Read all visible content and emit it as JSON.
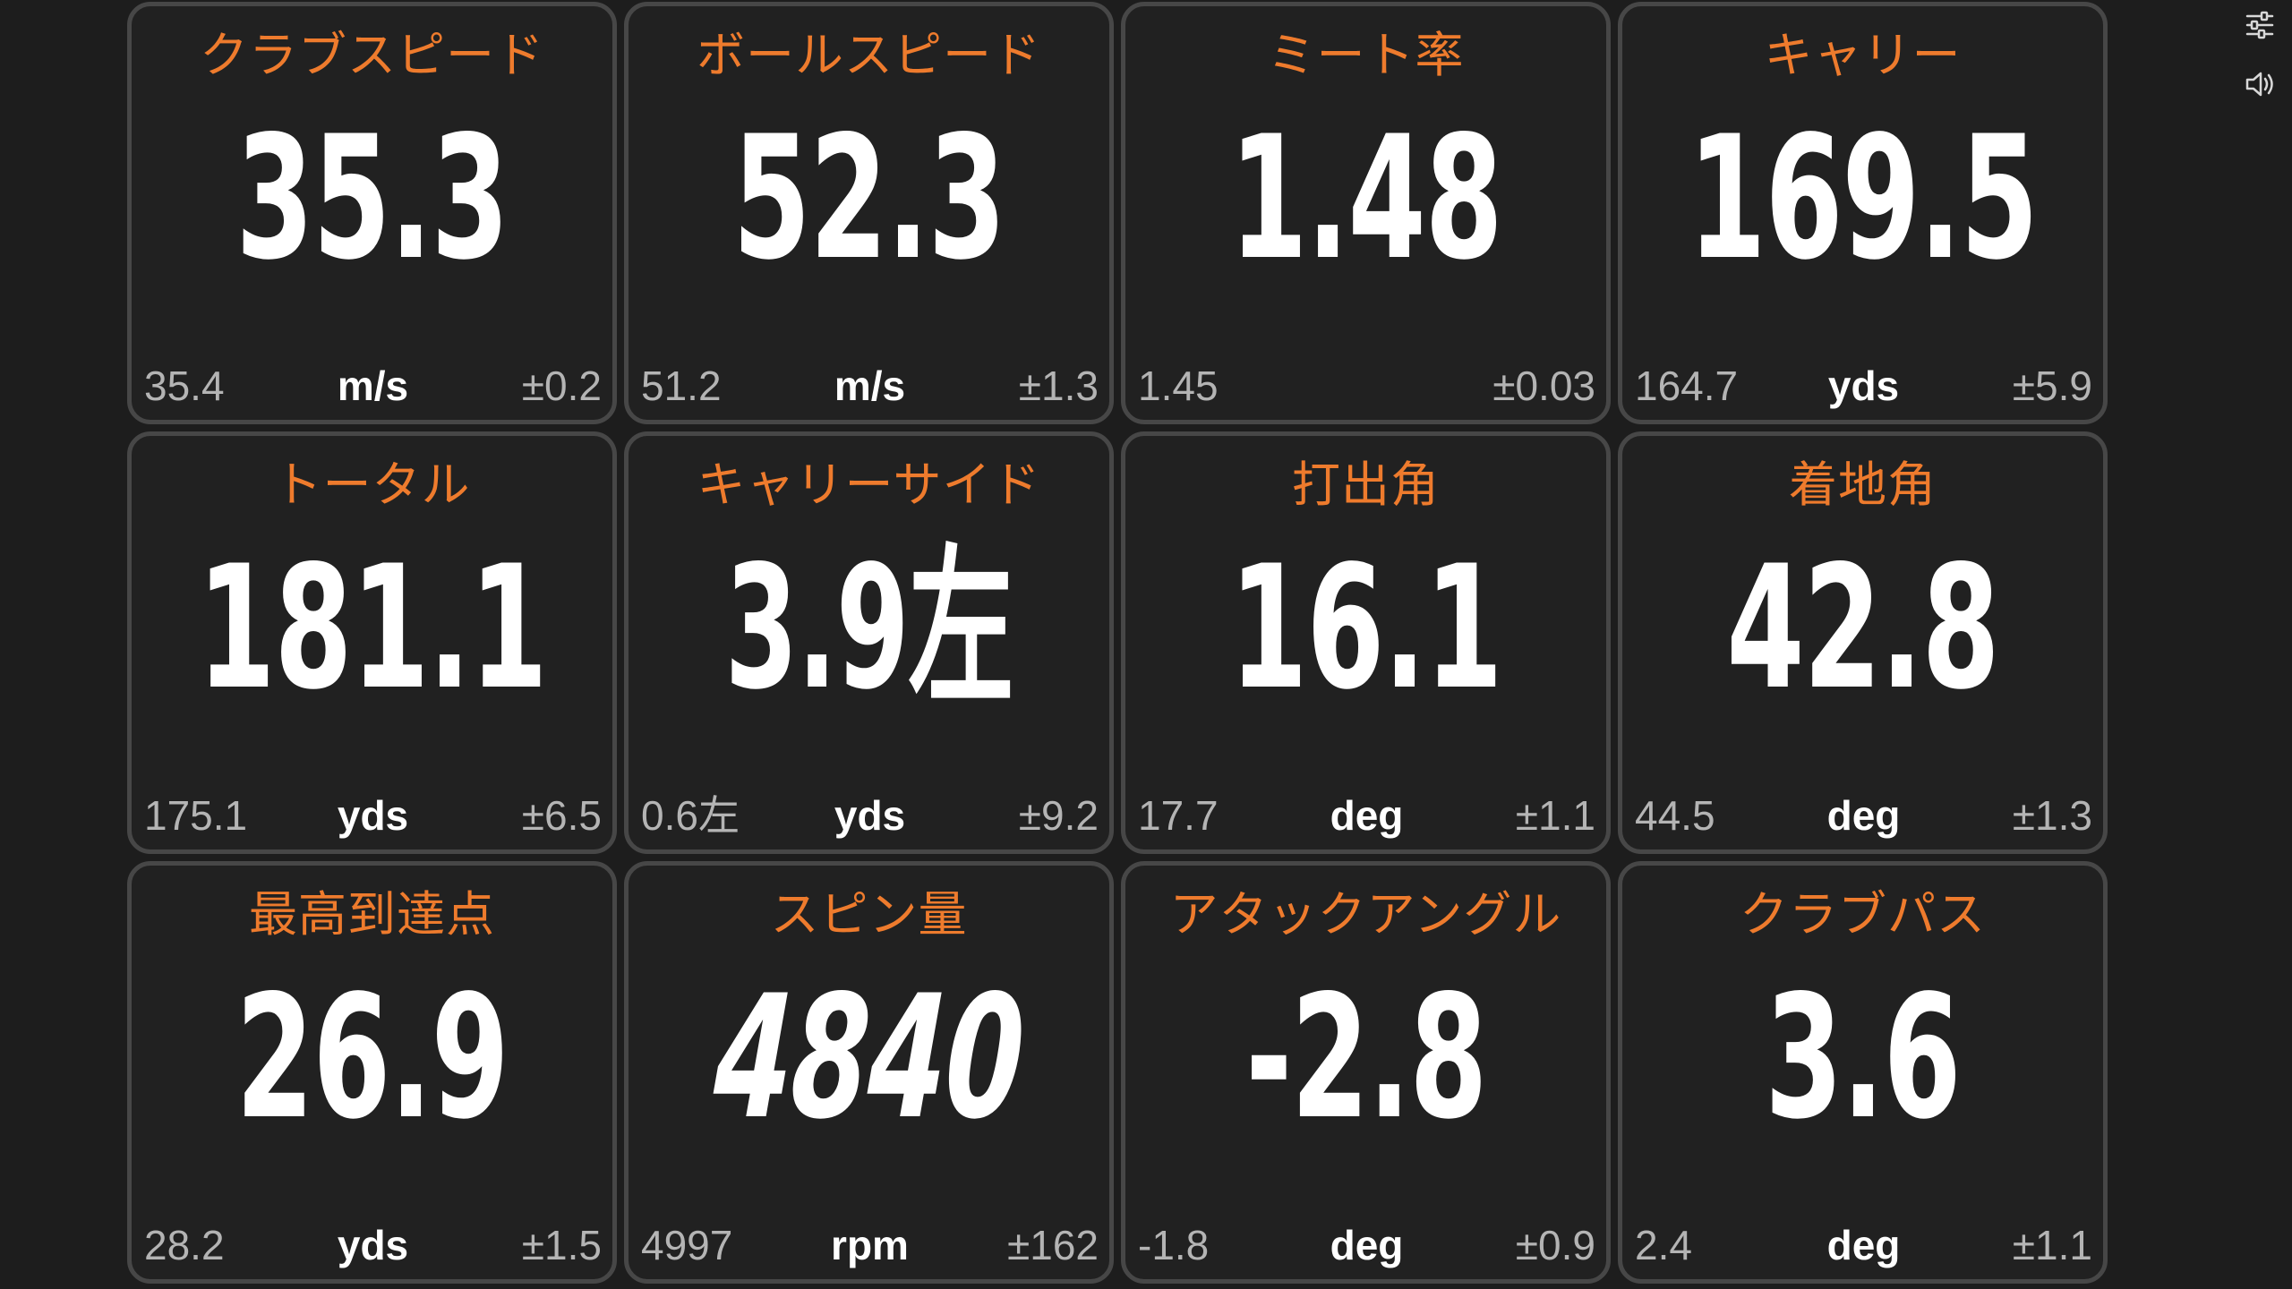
{
  "cards": [
    {
      "title": "クラブスピード",
      "value": "35.3",
      "avg": "35.4",
      "unit": "m/s",
      "dev": "±0.2"
    },
    {
      "title": "ボールスピード",
      "value": "52.3",
      "avg": "51.2",
      "unit": "m/s",
      "dev": "±1.3"
    },
    {
      "title": "ミート率",
      "value": "1.48",
      "avg": "1.45",
      "unit": "",
      "dev": "±0.03"
    },
    {
      "title": "キャリー",
      "value": "169.5",
      "avg": "164.7",
      "unit": "yds",
      "dev": "±5.9"
    },
    {
      "title": "トータル",
      "value": "181.1",
      "avg": "175.1",
      "unit": "yds",
      "dev": "±6.5"
    },
    {
      "title": "キャリーサイド",
      "value": "3.9左",
      "avg": "0.6左",
      "unit": "yds",
      "dev": "±9.2"
    },
    {
      "title": "打出角",
      "value": "16.1",
      "avg": "17.7",
      "unit": "deg",
      "dev": "±1.1"
    },
    {
      "title": "着地角",
      "value": "42.8",
      "avg": "44.5",
      "unit": "deg",
      "dev": "±1.3"
    },
    {
      "title": "最高到達点",
      "value": "26.9",
      "avg": "28.2",
      "unit": "yds",
      "dev": "±1.5"
    },
    {
      "title": "スピン量",
      "value": "4840",
      "avg": "4997",
      "unit": "rpm",
      "dev": "±162"
    },
    {
      "title": "アタックアングル",
      "value": "-2.8",
      "avg": "-1.8",
      "unit": "deg",
      "dev": "±0.9"
    },
    {
      "title": "クラブパス",
      "value": "3.6",
      "avg": "2.4",
      "unit": "deg",
      "dev": "±1.1"
    }
  ],
  "toolbar": {
    "settings_icon": "sliders-icon",
    "sound_icon": "speaker-icon"
  },
  "colors": {
    "background": "#1d1d1d",
    "card": "#212121",
    "card_border": "#474747",
    "title": "#ee7b2d",
    "value": "#ffffff",
    "secondary": "#b4b4b4"
  }
}
